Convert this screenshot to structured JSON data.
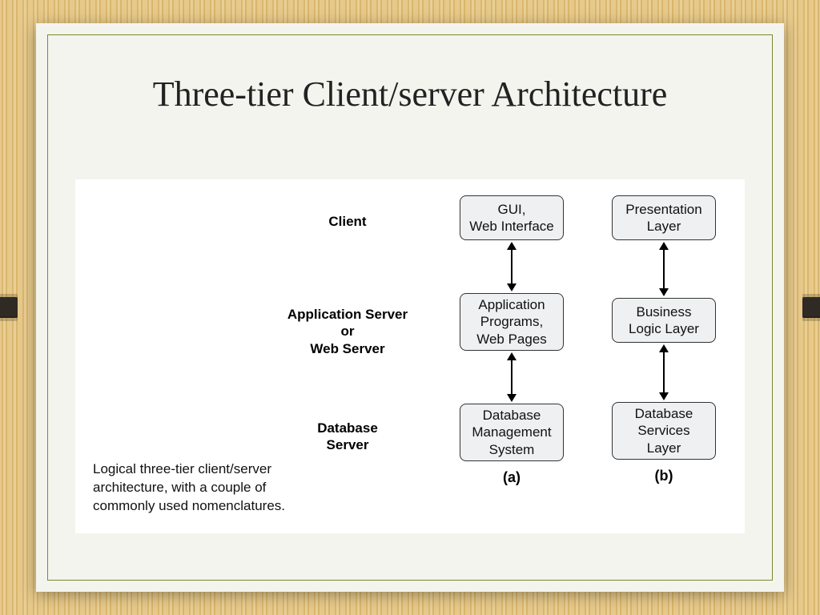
{
  "slide": {
    "title": "Three-tier Client/server Architecture",
    "caption": "Logical three-tier client/server architecture, with a couple of commonly used nomenclatures."
  },
  "diagram": {
    "rows": [
      "Client",
      "Application Server\nor\nWeb Server",
      "Database\nServer"
    ],
    "columns": {
      "a": {
        "label": "(a)",
        "nodes": [
          "GUI,\nWeb Interface",
          "Application\nPrograms,\nWeb Pages",
          "Database\nManagement\nSystem"
        ]
      },
      "b": {
        "label": "(b)",
        "nodes": [
          "Presentation\nLayer",
          "Business\nLogic Layer",
          "Database\nServices\nLayer"
        ]
      }
    }
  }
}
